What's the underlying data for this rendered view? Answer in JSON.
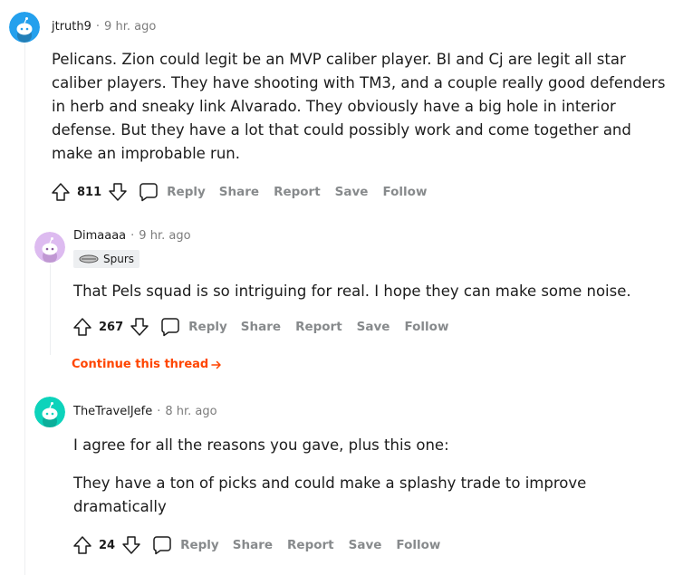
{
  "comments": [
    {
      "author": "jtruth9",
      "time": "9 hr. ago",
      "body_lines": [
        "Pelicans. Zion could legit be an MVP caliber player. BI and Cj are legit all star",
        "caliber players. They have shooting with TM3, and a couple really good defenders",
        "in herb and sneaky link Alvarado. They obviously have a big hole in interior",
        "defense. But they have a lot that could possibly work and come together and",
        "make an improbable run."
      ],
      "score": "811",
      "avatar_color": "#24a0ed"
    },
    {
      "author": "Dimaaaa",
      "time": "9 hr. ago",
      "flair": "Spurs",
      "body_lines": [
        "That Pels squad is so intriguing for real. I hope they can make some noise."
      ],
      "score": "267",
      "avatar_color": "#ddbbf0"
    },
    {
      "author": "TheTravelJefe",
      "time": "8 hr. ago",
      "body_paragraph1": "I agree for all the reasons you gave, plus this one:",
      "body_lines": [
        "They have a ton of picks and could make a splashy trade to improve",
        "dramatically"
      ],
      "score": "24",
      "avatar_color": "#0dd3bb"
    }
  ],
  "actions": {
    "reply": "Reply",
    "share": "Share",
    "report": "Report",
    "save": "Save",
    "follow": "Follow"
  },
  "continue_thread": "Continue this thread",
  "colors": {
    "accent": "#ff4500",
    "action_gray": "#878a8c",
    "text": "#1c1c1c",
    "meta_gray": "#7c7c7c"
  },
  "icons": [
    "upvote-icon",
    "downvote-icon",
    "comment-bubble-icon",
    "arrow-right-icon",
    "snoo-avatar-icon",
    "spurs-flair-icon"
  ]
}
